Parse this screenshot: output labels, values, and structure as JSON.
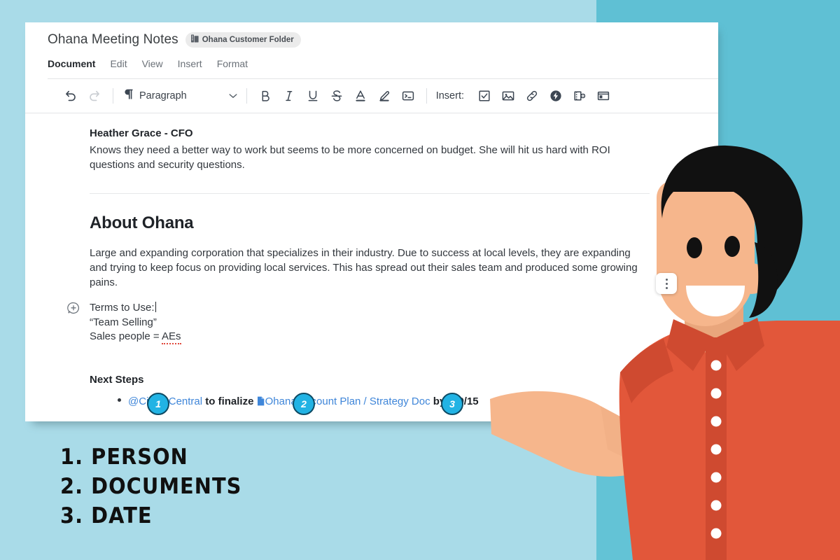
{
  "app": {
    "background_color": "#a9dbe8",
    "band_color": "#63c3d6"
  },
  "document": {
    "title": "Ohana Meeting Notes",
    "folder_badge": {
      "label": "Ohana Customer Folder",
      "icon": "folder-icon"
    },
    "menu": [
      {
        "label": "Document",
        "active": true
      },
      {
        "label": "Edit",
        "active": false
      },
      {
        "label": "View",
        "active": false
      },
      {
        "label": "Insert",
        "active": false
      },
      {
        "label": "Format",
        "active": false
      }
    ]
  },
  "toolbar": {
    "undo": {
      "icon": "undo-icon",
      "enabled": true
    },
    "redo": {
      "icon": "redo-icon",
      "enabled": false
    },
    "style_select": {
      "icon": "paragraph-mark-icon",
      "value": "Paragraph",
      "caret": "chevron-down-icon"
    },
    "format_buttons": [
      {
        "name": "bold-button",
        "glyph": "B"
      },
      {
        "name": "italic-button",
        "glyph": "I"
      },
      {
        "name": "underline-button",
        "glyph": "U"
      },
      {
        "name": "strikethrough-button",
        "glyph": "S"
      },
      {
        "name": "text-color-button",
        "glyph": "A"
      },
      {
        "name": "highlight-button",
        "glyph": "pen"
      },
      {
        "name": "code-button",
        "glyph": "code"
      }
    ],
    "insert_label": "Insert:",
    "insert_buttons": [
      {
        "name": "checklist-button",
        "icon": "checkbox-icon"
      },
      {
        "name": "image-button",
        "icon": "image-icon"
      },
      {
        "name": "link-button",
        "icon": "link-icon"
      },
      {
        "name": "action-button",
        "icon": "lightning-bolt-icon"
      },
      {
        "name": "add-section-button",
        "icon": "add-panel-icon"
      },
      {
        "name": "template-button",
        "icon": "layout-icon"
      }
    ]
  },
  "content": {
    "person_heading": "Heather Grace - CFO",
    "person_body": "Knows they need a better way to work but seems to be more concerned on budget. She will hit us hard with ROI questions and security questions.",
    "about_heading": "About Ohana",
    "about_body": "Large and expanding corporation that specializes in their industry. Due to success at local levels, they are expanding and trying to keep focus on providing local services. This has spread out their sales team and produced some growing pains.",
    "terms": {
      "line1": "Terms to Use:",
      "line2": "“Team Selling”",
      "line3_prefix": "Sales people = ",
      "line3_misspelled": "AEs",
      "comment_icon": "add-comment-icon"
    },
    "next_steps_heading": "Next Steps",
    "next_step_item": {
      "mention": "@Cindy Central",
      "middle": " to finalize ",
      "doc_icon": "document-icon",
      "doc_link": "Ohana Account Plan / Strategy Doc",
      "by": " by ",
      "date_icon": "calendar-icon",
      "date": "9/15"
    }
  },
  "overflow_menu": {
    "icon": "kebab-menu-icon"
  },
  "callouts": {
    "badges": [
      {
        "number": "1"
      },
      {
        "number": "2"
      },
      {
        "number": "3"
      }
    ],
    "legend": [
      "1. PERSON",
      "2. DOCUMENTS",
      "3. DATE"
    ],
    "badge_fill": "#22b3e4",
    "badge_ring": "#0d4a63"
  },
  "illustration": {
    "name": "presenter-illustration",
    "shirt_color": "#e2573a",
    "skin_color": "#f6b68c",
    "hair_color": "#111111"
  }
}
